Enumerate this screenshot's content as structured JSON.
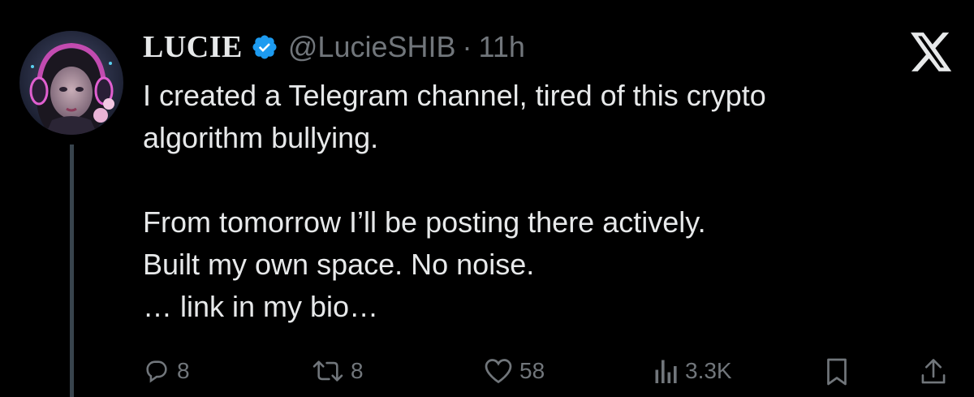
{
  "author": {
    "display_name": "LUCIE",
    "handle": "@LucieSHIB",
    "separator": "·",
    "time": "11h",
    "avatar_icon": "avatar-image",
    "verified_icon": "verified-badge-icon",
    "verified_color": "#1d9bf0"
  },
  "header": {
    "logo_icon": "x-logo-icon"
  },
  "tweet": {
    "lines": [
      "I created a Telegram channel, tired of this crypto",
      "algorithm bullying.",
      "From tomorrow I’ll be posting there actively.",
      "Built my own space. No noise.",
      "… link in my bio…"
    ]
  },
  "actions": {
    "reply": {
      "icon": "reply-icon",
      "count": "8"
    },
    "retweet": {
      "icon": "retweet-icon",
      "count": "8"
    },
    "like": {
      "icon": "heart-icon",
      "count": "58"
    },
    "views": {
      "icon": "views-chart-icon",
      "count": "3.3K"
    },
    "bookmark": {
      "icon": "bookmark-icon"
    },
    "share": {
      "icon": "share-icon"
    }
  },
  "colors": {
    "background": "#000000",
    "text_primary": "#e7e9ea",
    "text_secondary": "#71767b",
    "thread_line": "#38444d"
  }
}
